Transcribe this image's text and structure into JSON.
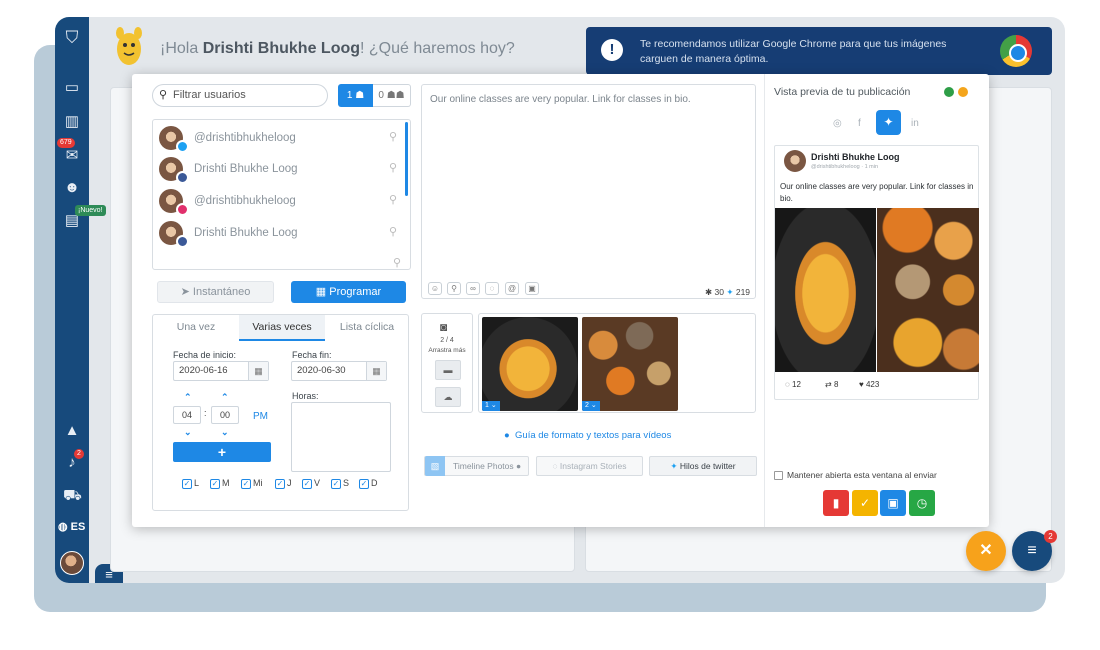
{
  "header": {
    "greeting_prefix": "¡Hola ",
    "user_name": "Drishti Bhukhe Loog",
    "greeting_suffix": "! ¿Qué haremos hoy?",
    "chrome_notice": "Te recomendamos utilizar Google Chrome para que tus imágenes carguen de manera óptima."
  },
  "sidebar": {
    "badge_messages": "679",
    "badge_new": "¡Nuevo!",
    "badge_alerts": "2",
    "language": "ES"
  },
  "user_filter": {
    "placeholder": "Filtrar usuarios",
    "single_count": "1",
    "group_count": "0"
  },
  "accounts": [
    {
      "name": "@drishtibhukheloog",
      "network": "twitter",
      "color": "#1da1f2"
    },
    {
      "name": "Drishti Bhukhe Loog",
      "network": "facebook",
      "color": "#3b5998"
    },
    {
      "name": "@drishtibhukheloog",
      "network": "instagram",
      "color": "#e1306c"
    },
    {
      "name": "Drishti Bhukhe Loog",
      "network": "facebook",
      "color": "#3b5998"
    }
  ],
  "mode_buttons": {
    "instant": "Instantáneo",
    "program": "Programar"
  },
  "schedule": {
    "tabs": [
      "Una vez",
      "Varias veces",
      "Lista cíclica"
    ],
    "active_tab": "Varias veces",
    "start_label": "Fecha de inicio:",
    "start_date": "2020-06-16",
    "end_label": "Fecha fin:",
    "end_date": "2020-06-30",
    "hour": "04",
    "minute": "00",
    "ampm": "PM",
    "hours_label": "Horas:",
    "days": [
      "L",
      "M",
      "Mi",
      "J",
      "V",
      "S",
      "D"
    ]
  },
  "compose": {
    "text": "Our online classes are very popular. Link for classes in bio.",
    "counter_left": "30",
    "counter_right": "219"
  },
  "media": {
    "count": "2 / 4",
    "drag_hint": "Arrastra más",
    "thumb_numbers": [
      "1",
      "2"
    ]
  },
  "guide_link": "Guía de formato y textos para vídeos",
  "post_types": {
    "timeline": "Timeline Photos",
    "instagram": "Instagram Stories",
    "twitter": "Hilos de twitter"
  },
  "preview": {
    "title": "Vista previa de tu publicación",
    "name": "Drishti Bhukhe Loog",
    "handle": "@drishtibhukheloog · 1 min",
    "text": "Our online classes are very popular. Link for classes in bio.",
    "replies": "12",
    "retweets": "8",
    "likes": "423"
  },
  "keep_open": "Mantener abierta esta ventana al enviar",
  "chat_badge": "2",
  "colors": {
    "primary": "#1e88e5",
    "sidebar": "#174a7c",
    "delete": "#e53935",
    "approve": "#f4b400",
    "save": "#1e88e5",
    "schedule": "#27a745",
    "fab_close": "#f7a21b"
  }
}
